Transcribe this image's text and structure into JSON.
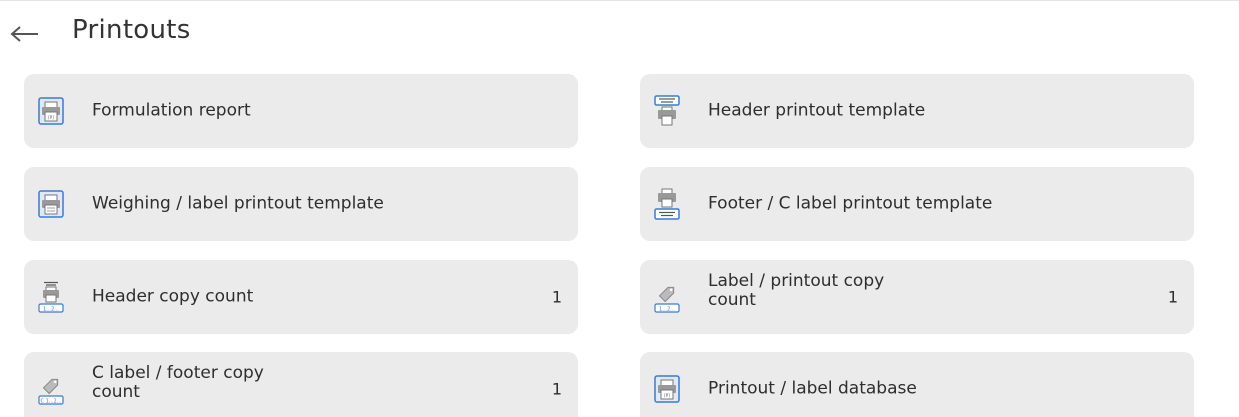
{
  "header": {
    "title": "Printouts",
    "back_icon": "arrow-left-icon"
  },
  "tiles": [
    {
      "label": "Formulation report",
      "value": "",
      "icon": "printer-report-icon"
    },
    {
      "label": "Header printout template",
      "value": "",
      "icon": "header-printer-icon"
    },
    {
      "label": "Weighing / label printout template",
      "value": "",
      "icon": "printer-icon"
    },
    {
      "label": "Footer / C label printout template",
      "value": "",
      "icon": "footer-printer-icon"
    },
    {
      "label": "Header copy count",
      "value": "1",
      "icon": "header-copy-count-icon"
    },
    {
      "label_line1": "Label / printout copy",
      "label_line2": "count",
      "value": "1",
      "icon": "label-copy-count-icon"
    },
    {
      "label_line1": "C label / footer copy",
      "label_line2": "count",
      "value": "1",
      "icon": "c-label-copy-count-icon"
    },
    {
      "label": "Printout / label database",
      "value": "",
      "icon": "printer-database-icon"
    }
  ],
  "colors": {
    "tile_bg": "#ebebeb",
    "icon_blue": "#3a7bd5"
  }
}
